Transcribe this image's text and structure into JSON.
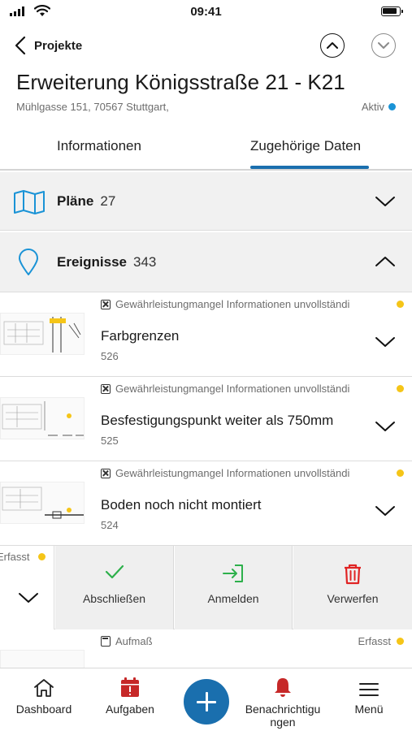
{
  "status_bar": {
    "time": "09:41"
  },
  "nav": {
    "back_label": "Projekte"
  },
  "project": {
    "title": "Erweiterung Königsstraße 21 - K21",
    "address": "Mühlgasse 151, 70567 Stuttgart,",
    "status": "Aktiv",
    "status_color": "#1a93d6"
  },
  "tabs": [
    {
      "label": "Informationen",
      "active": false
    },
    {
      "label": "Zugehörige Daten",
      "active": true
    }
  ],
  "sections": {
    "plaene": {
      "title": "Pläne",
      "count": "27",
      "expanded": false
    },
    "ereignisse": {
      "title": "Ereignisse",
      "count": "343",
      "expanded": true
    }
  },
  "events": [
    {
      "tag": "Gewährleistungmangel Informationen unvollständi",
      "title": "Farbgrenzen",
      "number": "526",
      "status_color": "#f5c518"
    },
    {
      "tag": "Gewährleistungmangel Informationen unvollständi",
      "title": "Besfestigungspunkt weiter als 750mm",
      "number": "525",
      "status_color": "#f5c518"
    },
    {
      "tag": "Gewährleistungmangel Informationen unvollständi",
      "title": "Boden noch nicht montiert",
      "number": "524",
      "status_color": "#f5c518"
    }
  ],
  "swipe_row": {
    "status": "Erfasst",
    "actions": [
      {
        "label": "Abschließen",
        "icon": "check-icon",
        "color": "#2db04b"
      },
      {
        "label": "Anmelden",
        "icon": "sign-in-icon",
        "color": "#2db04b"
      },
      {
        "label": "Verwerfen",
        "icon": "trash-icon",
        "color": "#e02424"
      }
    ]
  },
  "last_row": {
    "tag": "Aufmaß",
    "status": "Erfasst",
    "status_color": "#f5c518"
  },
  "tabbar": {
    "dashboard": "Dashboard",
    "tasks": "Aufgaben",
    "notifications": "Benachrichtigu ngen",
    "menu": "Menü",
    "accent": "#1a6fae",
    "badge_color": "#e02424"
  }
}
